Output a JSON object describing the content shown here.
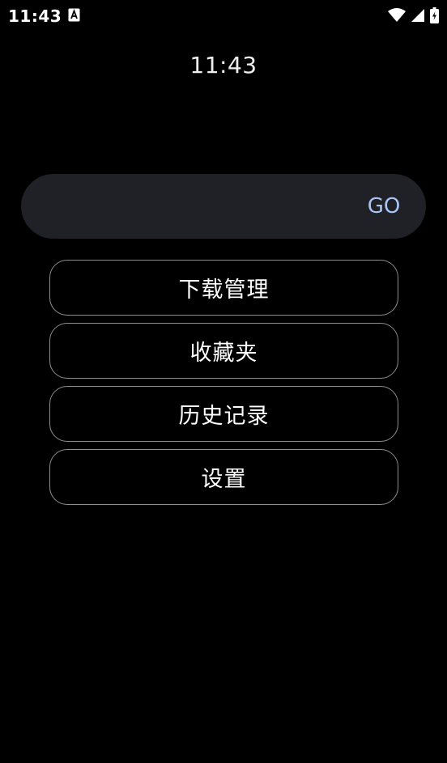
{
  "status_bar": {
    "time": "11:43",
    "icons": [
      "notification-a-icon",
      "wifi-icon",
      "cell-signal-icon",
      "battery-charging-icon"
    ]
  },
  "clock": {
    "time": "11:43"
  },
  "search": {
    "placeholder": "",
    "value": "",
    "go_label": "GO"
  },
  "menu": {
    "items": [
      {
        "label": "下载管理"
      },
      {
        "label": "收藏夹"
      },
      {
        "label": "历史记录"
      },
      {
        "label": "设置"
      }
    ]
  },
  "colors": {
    "background": "#000000",
    "search_bg": "#1f2126",
    "go_text": "#a9c4f5",
    "button_border": "#8d8d8d"
  }
}
